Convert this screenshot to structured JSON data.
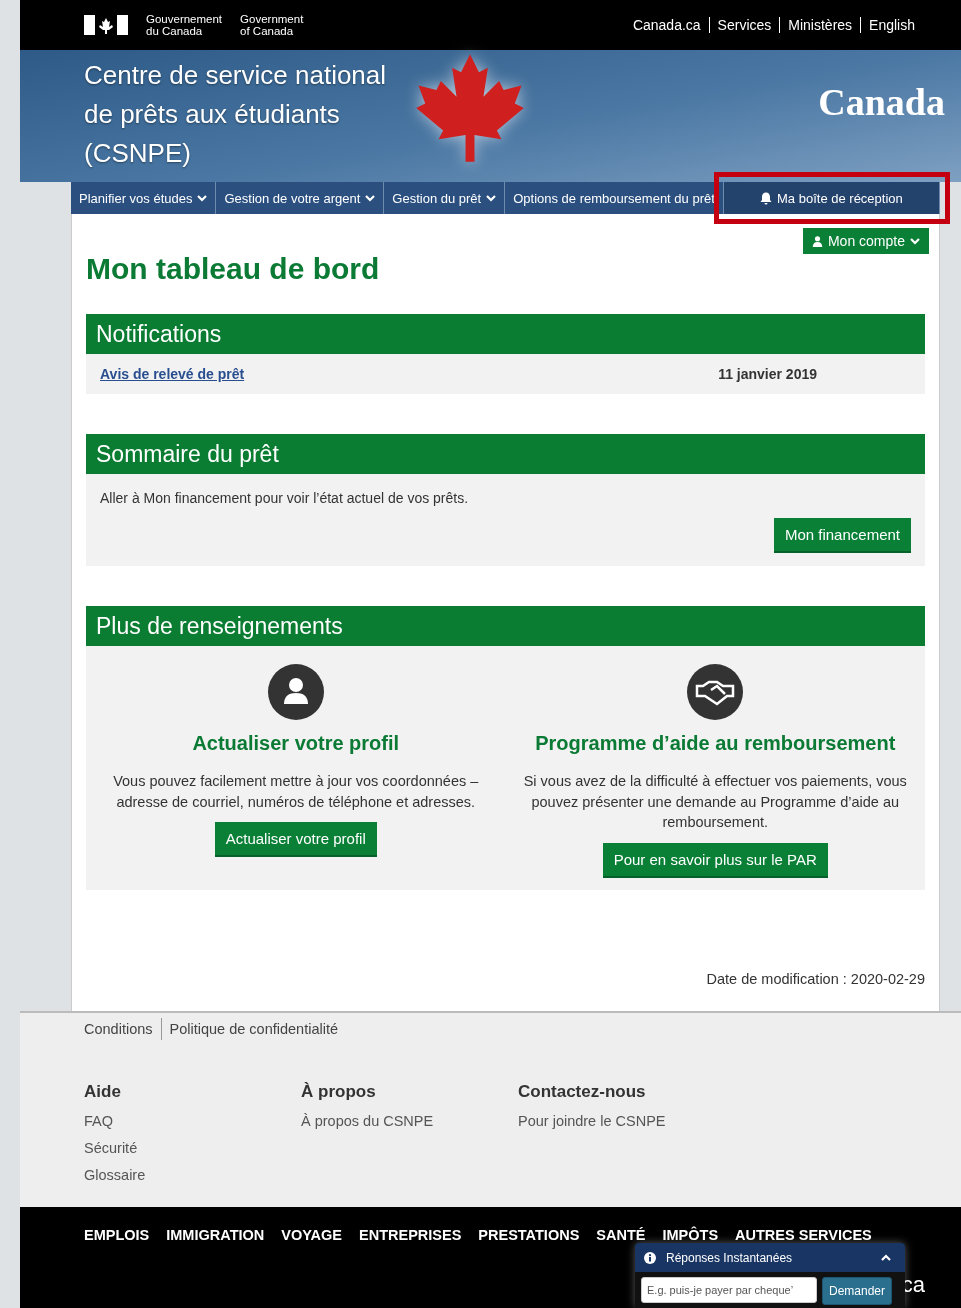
{
  "top_bar": {
    "gov_fr": [
      "Gouvernement",
      "du Canada"
    ],
    "gov_en": [
      "Government",
      "of Canada"
    ],
    "links": [
      "Canada.ca",
      "Services",
      "Ministères",
      "English"
    ]
  },
  "header": {
    "title": "Centre de service national de prêts aux étudiants (CSNPE)",
    "wordmark": "Canada"
  },
  "nav": [
    {
      "label": "Planifier vos études",
      "dropdown": true,
      "highlighted": false
    },
    {
      "label": "Gestion de votre argent",
      "dropdown": true,
      "highlighted": false
    },
    {
      "label": "Gestion du prêt",
      "dropdown": true,
      "highlighted": false
    },
    {
      "label": "Options de remboursement du prêt",
      "dropdown": false,
      "highlighted": false
    },
    {
      "label": "Ma boîte de réception",
      "dropdown": false,
      "highlighted": true
    }
  ],
  "account_button": "Mon compte",
  "page_title": "Mon tableau de bord",
  "notifications": {
    "title": "Notifications",
    "items": [
      {
        "link": "Avis de relevé de prêt",
        "date": "11 janvier 2019"
      }
    ]
  },
  "loan_summary": {
    "title": "Sommaire du prêt",
    "text": "Aller à Mon financement pour voir l’état actuel de vos prêts.",
    "button": "Mon financement"
  },
  "more_info": {
    "title": "Plus de renseignements",
    "cards": [
      {
        "kind": "person",
        "heading": "Actualiser votre profil",
        "text": "Vous pouvez facilement mettre à jour vos coordonnées – adresse de courriel, numéros de téléphone et adresses.",
        "button": "Actualiser votre profil"
      },
      {
        "kind": "handshake",
        "heading": "Programme d’aide au remboursement",
        "text": "Si vous avez de la difficulté à effectuer vos paiements, vous pouvez présenter une demande au Programme d’aide au remboursement.",
        "button": "Pour en savoir plus sur le PAR"
      }
    ]
  },
  "modified": "Date de modification : 2020-02-29",
  "footer": {
    "legal": [
      "Conditions",
      "Politique de confidentialité"
    ],
    "columns": [
      {
        "heading": "Aide",
        "links": [
          "FAQ",
          "Sécurité",
          "Glossaire"
        ]
      },
      {
        "heading": "À propos",
        "links": [
          "À propos du CSNPE"
        ]
      },
      {
        "heading": "Contactez-nous",
        "links": [
          "Pour joindre le CSNPE"
        ]
      }
    ],
    "themes": [
      "EMPLOIS",
      "IMMIGRATION",
      "VOYAGE",
      "ENTREPRISES",
      "PRESTATIONS",
      "SANTÉ",
      "IMPÔTS",
      "AUTRES SERVICES"
    ],
    "wordmark_tail": "ca"
  },
  "chat": {
    "title": "Réponses Instantanées",
    "expanded": true,
    "placeholder": "E.g. puis-je payer par cheque’",
    "button": "Demander"
  }
}
